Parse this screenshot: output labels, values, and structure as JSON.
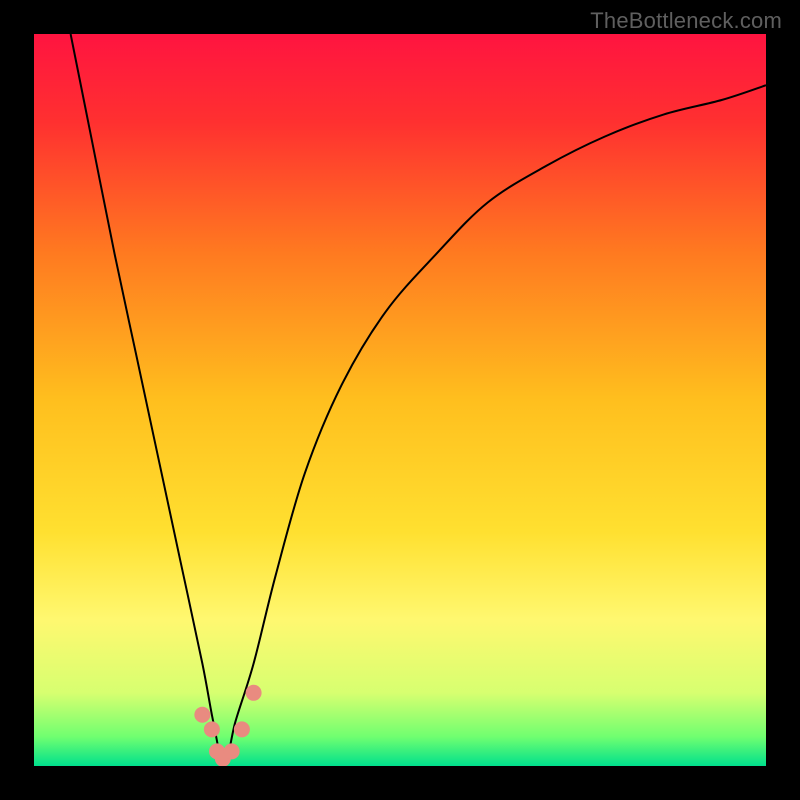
{
  "watermark": "TheBottleneck.com",
  "chart_data": {
    "type": "line",
    "title": "",
    "xlabel": "",
    "ylabel": "",
    "xlim": [
      0,
      100
    ],
    "ylim": [
      0,
      100
    ],
    "grid": false,
    "legend": false,
    "background": {
      "type": "vertical-gradient",
      "stops": [
        {
          "pos": 0.0,
          "color": "#ff1440"
        },
        {
          "pos": 0.12,
          "color": "#ff3030"
        },
        {
          "pos": 0.3,
          "color": "#ff7a20"
        },
        {
          "pos": 0.5,
          "color": "#ffbf1e"
        },
        {
          "pos": 0.68,
          "color": "#ffe030"
        },
        {
          "pos": 0.8,
          "color": "#fff870"
        },
        {
          "pos": 0.9,
          "color": "#d7ff70"
        },
        {
          "pos": 0.96,
          "color": "#70ff70"
        },
        {
          "pos": 1.0,
          "color": "#00e08c"
        }
      ]
    },
    "series": [
      {
        "name": "bottleneck-curve",
        "stroke": "#000000",
        "stroke_width": 2,
        "x": [
          5,
          8,
          11,
          14,
          17,
          20,
          23,
          24.5,
          26,
          27.5,
          30,
          33,
          37,
          42,
          48,
          55,
          62,
          70,
          78,
          86,
          94,
          100
        ],
        "y": [
          100,
          85,
          70,
          56,
          42,
          28,
          14,
          6,
          0,
          6,
          14,
          26,
          40,
          52,
          62,
          70,
          77,
          82,
          86,
          89,
          91,
          93
        ]
      }
    ],
    "markers": {
      "name": "valley-points",
      "color": "#e98b80",
      "radius": 8,
      "points": [
        {
          "x": 23.0,
          "y": 7
        },
        {
          "x": 24.3,
          "y": 5
        },
        {
          "x": 25.0,
          "y": 2
        },
        {
          "x": 25.8,
          "y": 1
        },
        {
          "x": 27.0,
          "y": 2
        },
        {
          "x": 28.4,
          "y": 5
        },
        {
          "x": 30.0,
          "y": 10
        }
      ]
    }
  }
}
